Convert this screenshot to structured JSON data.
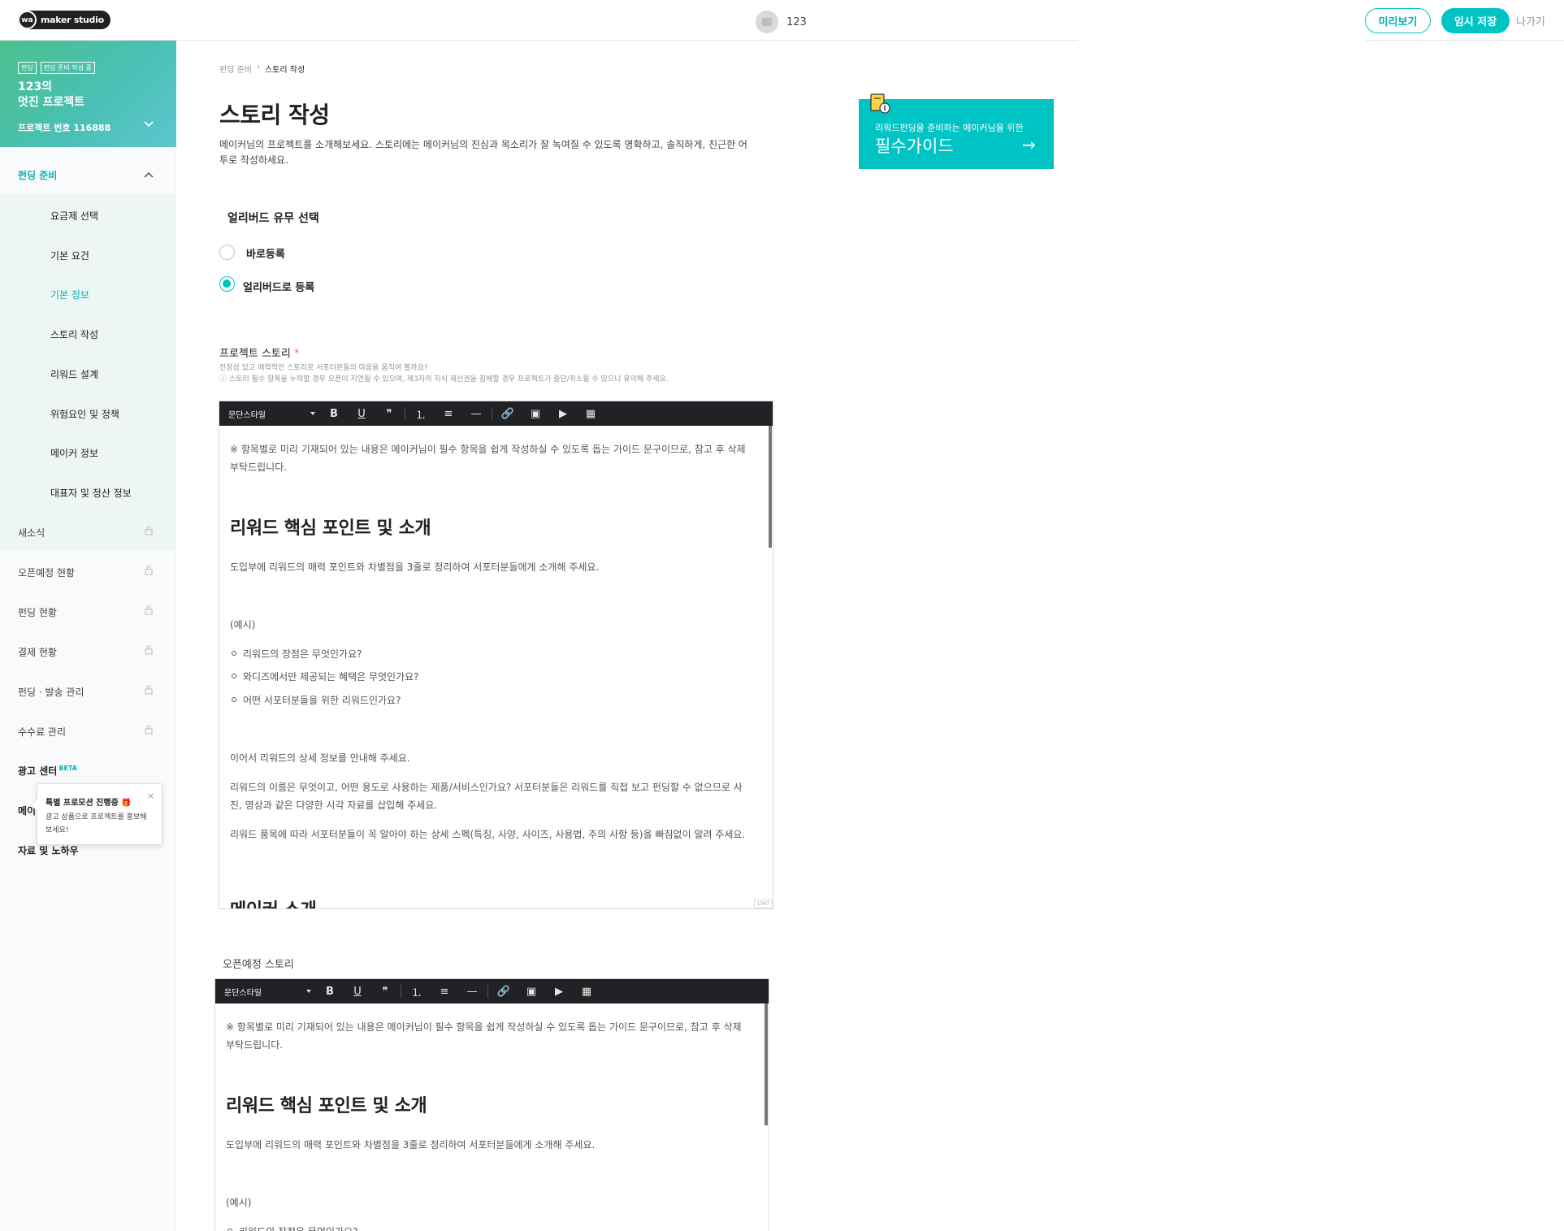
{
  "header": {
    "logo_mark": "wa",
    "logo_text": "maker studio",
    "project_id": "123",
    "preview_label": "미리보기",
    "save_label": "임시 저장",
    "exit_label": "나가기"
  },
  "sidebar": {
    "badges": [
      "펀딩",
      "펀딩 준비 작성 중"
    ],
    "project_title_line1": "123의",
    "project_title_line2": "멋진 프로젝트",
    "project_number": "프로젝트 번호 116888",
    "section_funding": "펀딩 준비",
    "sub_items": [
      {
        "label": "요금제 선택",
        "active": false
      },
      {
        "label": "기본 요건",
        "active": false
      },
      {
        "label": "기본 정보",
        "active": true
      },
      {
        "label": "스토리 작성",
        "active": false
      },
      {
        "label": "리워드 설계",
        "active": false
      },
      {
        "label": "위험요인 및 정책",
        "active": false
      },
      {
        "label": "메이커 정보",
        "active": false
      },
      {
        "label": "대표자 및 정산 정보",
        "active": false
      }
    ],
    "locked_items": [
      "새소식",
      "오픈예정 현황",
      "펀딩 현황",
      "결제 현황",
      "펀딩 · 발송 관리",
      "수수료 관리"
    ],
    "ad_center": "광고 센터",
    "ad_center_badge": "BETA",
    "maker_item_partial": "메이",
    "resources_item": "자료 및 노하우",
    "tooltip": {
      "title": "특별 프로모션 진행중 🎁",
      "desc": "광고 상품으로 프로젝트를 홍보해보세요!",
      "close": "×"
    },
    "accent_color": "#00c4c4"
  },
  "main": {
    "breadcrumb": [
      "펀딩 준비",
      "스토리 작성"
    ],
    "title": "스토리 작성",
    "description": "메이커님의 프로젝트를 소개해보세요. 스토리에는 메이커님의 진심과 목소리가 잘 녹여질 수 있도록 명확하고, 솔직하게, 친근한 어투로 작성하세요.",
    "guide": {
      "sub": "리워드펀딩을 준비하는 메이커님을 위한",
      "main": "필수가이드",
      "arrow": "→"
    },
    "early_bird": {
      "title": "얼리버드 유무 선택",
      "options": [
        {
          "label": "바로등록",
          "selected": false
        },
        {
          "label": "얼리버드로 등록",
          "selected": true
        }
      ]
    },
    "story": {
      "label": "프로젝트 스토리",
      "required_mark": "*",
      "help1": "진정성 있고 매력적인 스토리로 서포터분들의 마음을 움직여 볼까요?",
      "help2": "ⓘ 스토리 필수 항목을 누락할 경우 오픈이 지연될 수 있으며, 제3자의 지식 재산권을 침해할 경우 프로젝트가 중단/취소될 수 있으니 유의해 주세요.",
      "char_count": "1567"
    },
    "toolbar": {
      "style_select": "문단스타일",
      "bold": "B",
      "underline": "U",
      "quote": "❞",
      "ordered_list": "⒈",
      "bullet_list": "≡",
      "hr": "—",
      "link": "🔗",
      "image": "▣",
      "video": "▶",
      "table": "▦"
    },
    "editor_content": {
      "notice": "※ 항목별로 미리 기재되어 있는 내용은 메이커님이 필수 항목을 쉽게 작성하실 수 있도록 돕는 가이드 문구이므로, 참고 후 삭제 부탁드립니다.",
      "heading1": "리워드 핵심 포인트 및 소개",
      "intro": "도입부에 리워드의 매력 포인트와 차별점을 3줄로 정리하여 서포터분들에게 소개해 주세요.",
      "example": "(예시)",
      "bullets": [
        "리워드의 장점은 무엇인가요?",
        "와디즈에서만 제공되는 혜택은 무엇인가요?",
        "어떤 서포터분들을 위한 리워드인가요?"
      ],
      "detail_intro": "이어서 리워드의 상세 정보를 안내해 주세요.",
      "detail1": "리워드의 이름은 무엇이고, 어떤 용도로 사용하는 제품/서비스인가요? 서포터분들은 리워드를 직접 보고 펀딩할 수 없으므로 사진, 영상과 같은 다양한 시각 자료를 삽입해 주세요.",
      "detail2": "리워드 품목에 따라 서포터분들이 꼭 알아야 하는 상세 스펙(특징, 사양, 사이즈, 사용법, 주의 사항 등)을 빠짐없이 알려 주세요.",
      "next_heading_partial": "메이커 소개"
    },
    "open_story": {
      "label": "오픈예정 스토리",
      "partial_bullet": "리워드의 장점은 무엇인가요?"
    }
  }
}
